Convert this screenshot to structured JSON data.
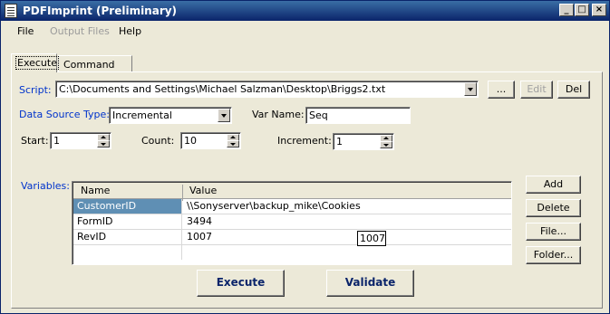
{
  "window": {
    "title": "PDFImprint (Preliminary)"
  },
  "menu": [
    {
      "label": "File",
      "enabled": true
    },
    {
      "label": "Output Files",
      "enabled": false
    },
    {
      "label": "Help",
      "enabled": true
    }
  ],
  "tabs": [
    {
      "label": "Execute",
      "active": true
    },
    {
      "label": "Command Line",
      "active": false
    }
  ],
  "script": {
    "label": "Script:",
    "value": "C:\\Documents and Settings\\Michael Salzman\\Desktop\\Briggs2.txt",
    "browse_label": "...",
    "edit_label": "Edit",
    "del_label": "Del"
  },
  "data_source": {
    "label": "Data Source Type:",
    "value": "Incremental",
    "var_name_label": "Var Name:",
    "var_name_value": "Seq"
  },
  "sequence": {
    "start_label": "Start:",
    "start_value": "1",
    "count_label": "Count:",
    "count_value": "10",
    "increment_label": "Increment:",
    "increment_value": "1"
  },
  "variables": {
    "label": "Variables:",
    "columns": [
      "Name",
      "Value"
    ],
    "rows": [
      {
        "name": "CustomerID",
        "value": "\\\\Sonyserver\\backup_mike\\Cookies",
        "selected": true
      },
      {
        "name": "FormID",
        "value": "3494",
        "selected": false
      },
      {
        "name": "RevID",
        "value": "1007",
        "selected": false
      }
    ],
    "tooltip": "1007",
    "buttons": {
      "add": "Add",
      "delete": "Delete",
      "file": "File...",
      "folder": "Folder..."
    }
  },
  "actions": {
    "execute": "Execute",
    "validate": "Validate"
  },
  "colors": {
    "title_bar": "#0a246a",
    "label_blue": "#0033cc",
    "selection": "#5f8fb4",
    "face": "#ece9d8"
  }
}
